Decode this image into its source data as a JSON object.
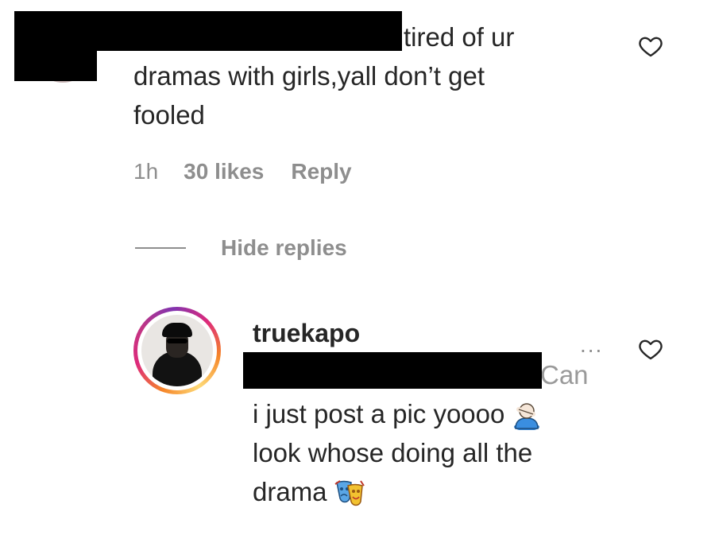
{
  "comment": {
    "text_lines": [
      "tired of ur",
      "dramas with girls,yall don’t get",
      "fooled"
    ],
    "time": "1h",
    "likes": "30 likes",
    "reply_label": "Reply",
    "hide_replies_label": "Hide replies"
  },
  "reply": {
    "username": "truekapo",
    "more_label": "...",
    "text_lines": [
      "Can",
      "i just post a pic yoooo",
      "look whose doing all the",
      "drama"
    ],
    "emojis": [
      "facepalm-emoji",
      "performing-arts-emoji"
    ]
  },
  "icons": [
    "heart-icon",
    "more-options-icon"
  ],
  "colors": {
    "text": "#262626",
    "secondary": "#8e8e8e",
    "redaction": "#000000",
    "story_ring_start": "#f58529",
    "story_ring_end": "#dd2a7b"
  }
}
